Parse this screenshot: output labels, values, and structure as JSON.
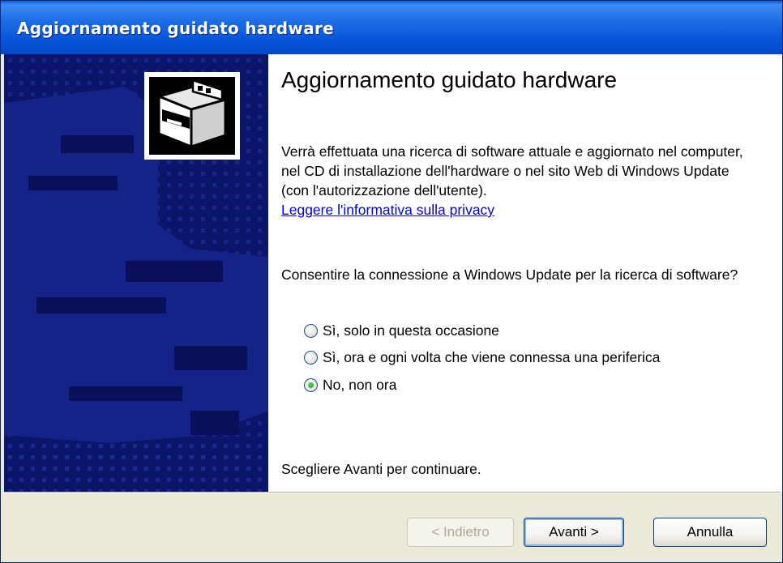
{
  "window": {
    "title": "Aggiornamento guidato hardware"
  },
  "wizard": {
    "heading": "Aggiornamento guidato hardware",
    "description": "Verrà effettuata una ricerca di software attuale e aggiornato nel computer, nel CD di installazione dell'hardware o nel sito Web di Windows Update (con l'autorizzazione dell'utente).",
    "privacy_link": "Leggere l'informativa sulla privacy",
    "question": "Consentire la connessione a Windows Update per la ricerca di software?",
    "options": [
      {
        "label": "Sì, solo in questa occasione",
        "checked": false
      },
      {
        "label": "Sì, ora e ogni volta che viene connessa una periferica",
        "checked": false
      },
      {
        "label": "No, non ora",
        "checked": true
      }
    ],
    "footer_text": "Scegliere Avanti per continuare."
  },
  "buttons": {
    "back": {
      "label": "< Indietro",
      "enabled": false
    },
    "next": {
      "label": "Avanti >",
      "enabled": true
    },
    "cancel": {
      "label": "Annulla",
      "enabled": true
    }
  },
  "colors": {
    "titlebar": "#0554d8",
    "side_panel": "#0b1569",
    "link": "#0000e0",
    "radio_selected": "#21a121"
  },
  "icons": {
    "wizard": "hardware-device-icon"
  }
}
